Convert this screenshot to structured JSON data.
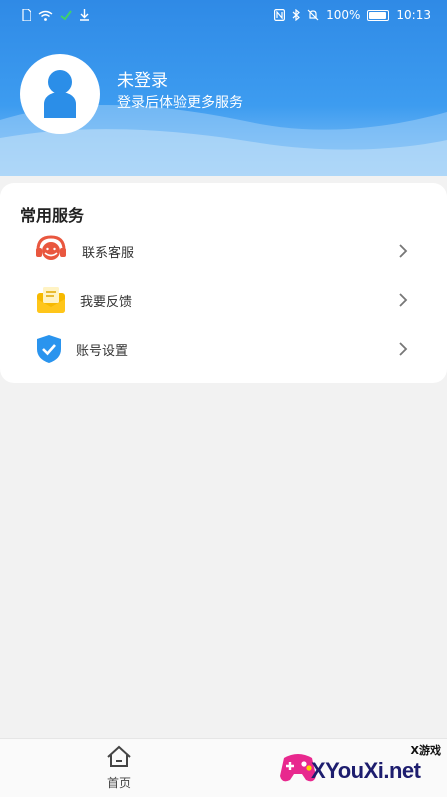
{
  "status_bar": {
    "battery_percent": "100%",
    "time": "10:13"
  },
  "header": {
    "title": "未登录",
    "subtitle": "登录后体验更多服务"
  },
  "services": {
    "title": "常用服务",
    "items": [
      {
        "label": "联系客服",
        "icon": "customer-service-icon"
      },
      {
        "label": "我要反馈",
        "icon": "feedback-envelope-icon"
      },
      {
        "label": "账号设置",
        "icon": "shield-check-icon"
      }
    ]
  },
  "tabbar": {
    "home_label": "首页"
  },
  "watermark": {
    "brand": "XYouXi.net",
    "tag": "X游戏"
  },
  "colors": {
    "header_blue": "#2f8ae6",
    "avatar_blue": "#2b8ee8",
    "service_red": "#e9573f",
    "feedback_yellow": "#f6b900",
    "shield_blue": "#2a94ee"
  }
}
